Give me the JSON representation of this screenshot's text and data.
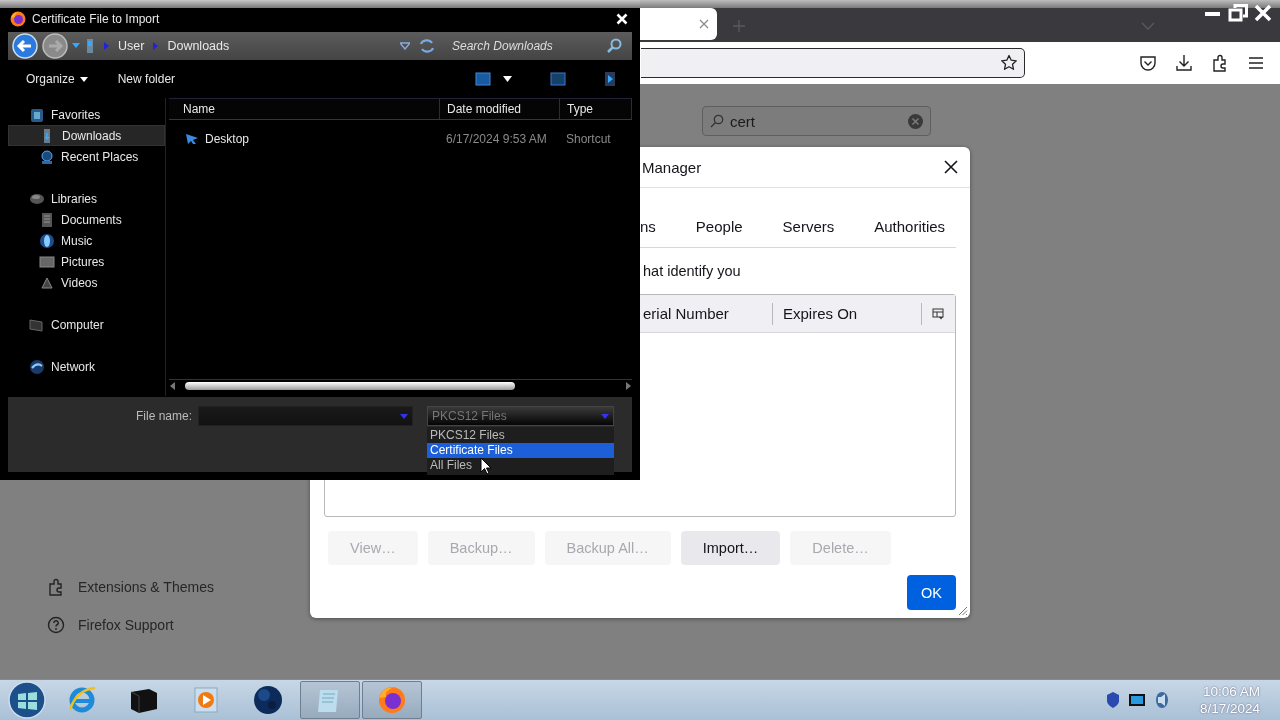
{
  "browser": {
    "addons_search": {
      "value": "cert"
    },
    "sidebar_links": [
      {
        "label": "Extensions & Themes",
        "kind": "extensions"
      },
      {
        "label": "Firefox Support",
        "kind": "support"
      }
    ]
  },
  "cert_manager": {
    "title": "Manager",
    "tabs": [
      {
        "label": "ns",
        "selected": false
      },
      {
        "label": "People",
        "selected": false
      },
      {
        "label": "Servers",
        "selected": false
      },
      {
        "label": "Authorities",
        "selected": false
      }
    ],
    "description": "hat identify you",
    "columns": [
      "erial Number",
      "Expires On"
    ],
    "buttons": [
      {
        "label": "View…",
        "disabled": true
      },
      {
        "label": "Backup…",
        "disabled": true
      },
      {
        "label": "Backup All…",
        "disabled": true
      },
      {
        "label": "Import…",
        "disabled": false
      },
      {
        "label": "Delete…",
        "disabled": true
      }
    ],
    "ok_button": "OK"
  },
  "file_dialog": {
    "title": "Certificate File to Import",
    "breadcrumb": [
      "User",
      "Downloads"
    ],
    "search_placeholder": "Search Downloads",
    "toolbar": [
      "Organize",
      "New folder"
    ],
    "nav": [
      {
        "label": "Favorites",
        "kind": "favorites",
        "selected": false,
        "children": [
          {
            "label": "Downloads",
            "kind": "downloads",
            "selected": true
          },
          {
            "label": "Recent Places",
            "kind": "recent",
            "selected": false
          }
        ]
      },
      {
        "label": "Libraries",
        "kind": "libraries",
        "selected": false,
        "children": [
          {
            "label": "Documents",
            "kind": "documents",
            "selected": false
          },
          {
            "label": "Music",
            "kind": "music",
            "selected": false
          },
          {
            "label": "Pictures",
            "kind": "pictures",
            "selected": false
          },
          {
            "label": "Videos",
            "kind": "videos",
            "selected": false
          }
        ]
      },
      {
        "label": "Computer",
        "kind": "computer",
        "selected": false
      },
      {
        "label": "Network",
        "kind": "network",
        "selected": false
      }
    ],
    "columns": [
      "Name",
      "Date modified",
      "Type"
    ],
    "files": [
      {
        "name": "Desktop",
        "date": "6/17/2024 9:53 AM",
        "type": "Shortcut"
      }
    ],
    "file_name_label": "File name:",
    "file_type": {
      "value": "PKCS12 Files",
      "options": [
        {
          "label": "PKCS12 Files",
          "highlighted": false
        },
        {
          "label": "Certificate Files",
          "highlighted": true
        },
        {
          "label": "All Files",
          "highlighted": false
        }
      ]
    }
  },
  "taskbar": {
    "apps": [
      {
        "kind": "ie",
        "active": false
      },
      {
        "kind": "terminal",
        "active": false
      },
      {
        "kind": "media",
        "active": false
      },
      {
        "kind": "globe",
        "active": false
      },
      {
        "kind": "notepad",
        "active": true
      },
      {
        "kind": "firefox",
        "active": true
      }
    ],
    "clock": {
      "time": "10:06 AM",
      "date": "8/17/2024"
    }
  }
}
